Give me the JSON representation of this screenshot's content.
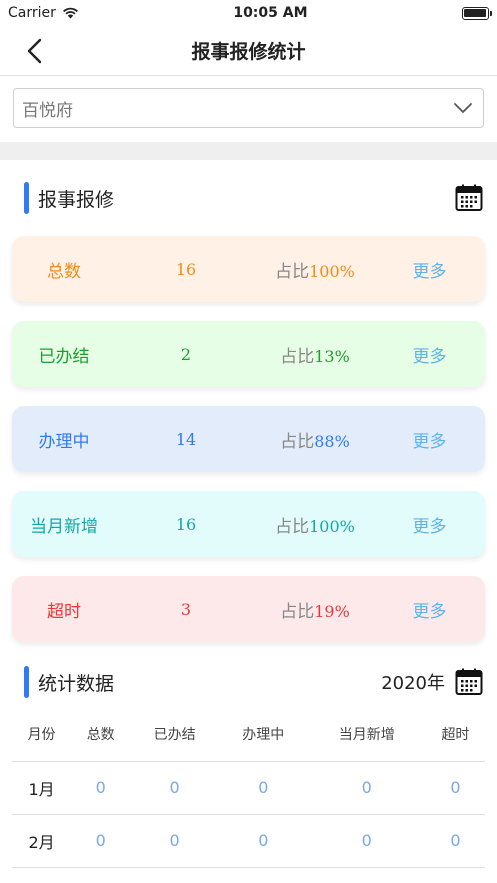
{
  "status_bar": {
    "carrier": "Carrier",
    "time": "10:05 AM"
  },
  "nav": {
    "title": "报事报修统计"
  },
  "selector": {
    "value": "百悦府"
  },
  "section1": {
    "title": "报事报修"
  },
  "cards": [
    {
      "label": "总数",
      "count": "16",
      "ratio_prefix": "占比",
      "ratio": "100%",
      "more": "更多",
      "color": "#f08c1c",
      "bg": "#fff1e5"
    },
    {
      "label": "已办结",
      "count": "2",
      "ratio_prefix": "占比",
      "ratio": "13%",
      "more": "更多",
      "color": "#1f9e2e",
      "bg": "#e6fde6"
    },
    {
      "label": "办理中",
      "count": "14",
      "ratio_prefix": "占比",
      "ratio": "88%",
      "more": "更多",
      "color": "#2f7bf6",
      "bg": "#e3ecfb"
    },
    {
      "label": "当月新增",
      "count": "16",
      "ratio_prefix": "占比",
      "ratio": "100%",
      "more": "更多",
      "color": "#13a8a8",
      "bg": "#e2fcfc"
    },
    {
      "label": "超时",
      "count": "3",
      "ratio_prefix": "占比",
      "ratio": "19%",
      "more": "更多",
      "color": "#e8383d",
      "bg": "#fde9e9"
    }
  ],
  "section2": {
    "title": "统计数据",
    "year": "2020年"
  },
  "table": {
    "headers": [
      "月份",
      "总数",
      "已办结",
      "办理中",
      "当月新增",
      "超时"
    ],
    "rows": [
      [
        "1月",
        "0",
        "0",
        "0",
        "0",
        "0"
      ],
      [
        "2月",
        "0",
        "0",
        "0",
        "0",
        "0"
      ]
    ]
  }
}
